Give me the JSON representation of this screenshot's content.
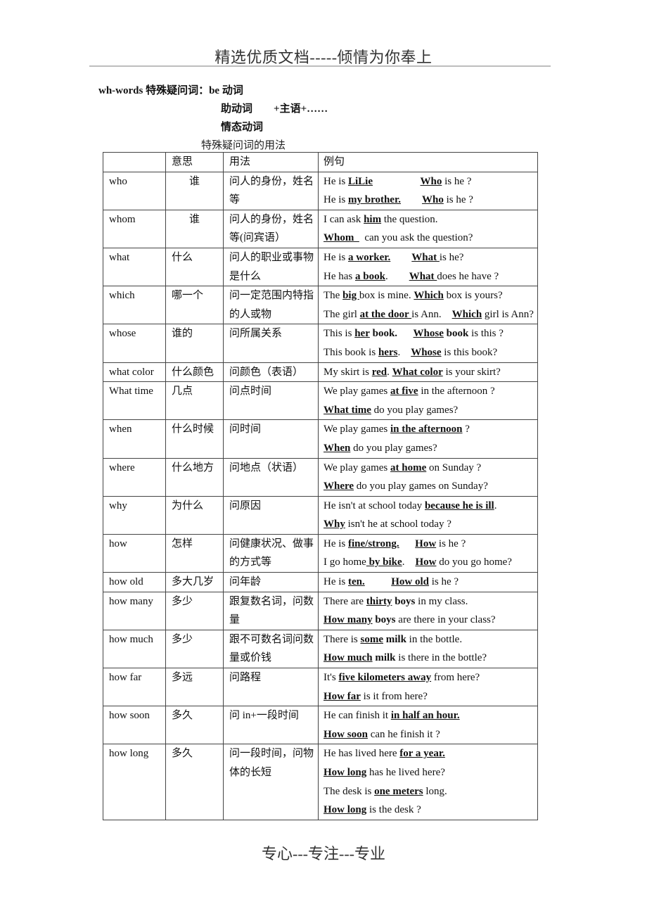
{
  "page_header": "精选优质文档-----倾情为你奉上",
  "intro": {
    "line1": "wh-words  特殊疑问词：be 动词",
    "line2_a": "助动词",
    "line2_b": "+主语+……",
    "line3": "情态动词"
  },
  "table_caption": "特殊疑问词的用法",
  "table": {
    "headers": [
      "",
      "意思",
      "用法",
      "例句"
    ],
    "rows": [
      {
        "word": "who",
        "meaning": "谁",
        "usage": "问人的身份，姓名等",
        "examples": [
          [
            {
              "t": "He is "
            },
            {
              "t": "LiLie",
              "s": "u"
            },
            {
              "t": "                  "
            },
            {
              "t": "Who",
              "s": "u"
            },
            {
              "t": " is he ?"
            }
          ],
          [
            {
              "t": "He is "
            },
            {
              "t": "my brother.",
              "s": "u"
            },
            {
              "t": "        "
            },
            {
              "t": "Who",
              "s": "u"
            },
            {
              "t": " is he ?"
            }
          ]
        ]
      },
      {
        "word": "whom",
        "meaning": "谁",
        "usage": "问人的身份，姓名等(问宾语）",
        "examples": [
          [
            {
              "t": "I can ask "
            },
            {
              "t": "him",
              "s": "u"
            },
            {
              "t": " the question."
            }
          ],
          [
            {
              "t": "Whom  ",
              "s": "u"
            },
            {
              "t": "  can you ask the question?"
            }
          ]
        ]
      },
      {
        "word": "what",
        "meaning": "什么",
        "usage": "问人的职业或事物是什么",
        "examples": [
          [
            {
              "t": "He is "
            },
            {
              "t": "a worker.",
              "s": "u"
            },
            {
              "t": "        "
            },
            {
              "t": "What ",
              "s": "u"
            },
            {
              "t": "is he?"
            }
          ],
          [
            {
              "t": "He has "
            },
            {
              "t": "a book",
              "s": "u"
            },
            {
              "t": ".        "
            },
            {
              "t": "What ",
              "s": "u"
            },
            {
              "t": "does he have ?"
            }
          ]
        ]
      },
      {
        "word": "which",
        "meaning": "哪一个",
        "usage": "问一定范围内特指的人或物",
        "examples": [
          [
            {
              "t": "The "
            },
            {
              "t": "big ",
              "s": "u"
            },
            {
              "t": "box is mine. "
            },
            {
              "t": "Which",
              "s": "u"
            },
            {
              "t": " box is yours?"
            }
          ],
          [
            {
              "t": "The girl "
            },
            {
              "t": "at the door ",
              "s": "u"
            },
            {
              "t": "is Ann.    "
            },
            {
              "t": "Which",
              "s": "u"
            },
            {
              "t": " girl is Ann?"
            }
          ]
        ]
      },
      {
        "word": "whose",
        "meaning": "谁的",
        "usage": "问所属关系",
        "examples": [
          [
            {
              "t": "This is "
            },
            {
              "t": "her",
              "s": "u"
            },
            {
              "t": " "
            },
            {
              "t": "book.",
              "s": "b"
            },
            {
              "t": "      "
            },
            {
              "t": "Whose",
              "s": "u"
            },
            {
              "t": " "
            },
            {
              "t": "book",
              "s": "b"
            },
            {
              "t": " is this ?"
            }
          ],
          [
            {
              "t": "This book is "
            },
            {
              "t": "hers",
              "s": "u"
            },
            {
              "t": ".    "
            },
            {
              "t": "Whose",
              "s": "u"
            },
            {
              "t": " is this book?"
            }
          ]
        ]
      },
      {
        "word": "what color",
        "meaning": "什么颜色",
        "usage": "问颜色（表语）",
        "examples": [
          [
            {
              "t": "My skirt is "
            },
            {
              "t": "red",
              "s": "u"
            },
            {
              "t": ". "
            },
            {
              "t": "What color",
              "s": "u"
            },
            {
              "t": " is your skirt?"
            }
          ]
        ]
      },
      {
        "word": "What time",
        "meaning": "几点",
        "usage": "问点时间",
        "examples": [
          [
            {
              "t": "We play games "
            },
            {
              "t": "at five",
              "s": "u"
            },
            {
              "t": " in the afternoon ?"
            }
          ],
          [
            {
              "t": "What time",
              "s": "u"
            },
            {
              "t": " do you play games?"
            }
          ]
        ]
      },
      {
        "word": "when",
        "meaning": "什么时候",
        "usage": "问时间",
        "examples": [
          [
            {
              "t": "We play games "
            },
            {
              "t": "in the afternoon",
              "s": "u"
            },
            {
              "t": " ?"
            }
          ],
          [
            {
              "t": "When",
              "s": "u"
            },
            {
              "t": " do you play games?"
            }
          ]
        ]
      },
      {
        "word": "where",
        "meaning": "什么地方",
        "usage": "问地点（状语）",
        "examples": [
          [
            {
              "t": "We play games "
            },
            {
              "t": "at home",
              "s": "u"
            },
            {
              "t": " on Sunday ?"
            }
          ],
          [
            {
              "t": "Where",
              "s": "u"
            },
            {
              "t": " do you play games on Sunday?"
            }
          ]
        ]
      },
      {
        "word": "why",
        "meaning": "为什么",
        "usage": "问原因",
        "examples": [
          [
            {
              "t": "He isn't at school today "
            },
            {
              "t": "because he is ill",
              "s": "u"
            },
            {
              "t": "."
            }
          ],
          [
            {
              "t": "Why",
              "s": "u"
            },
            {
              "t": " isn't he at school today ?"
            }
          ]
        ]
      },
      {
        "word": "how",
        "meaning": "怎样",
        "usage": "问健康状况、做事的方式等",
        "examples": [
          [
            {
              "t": "He is "
            },
            {
              "t": "fine/strong.",
              "s": "u"
            },
            {
              "t": "      "
            },
            {
              "t": "How",
              "s": "u"
            },
            {
              "t": " is he ?"
            }
          ],
          [
            {
              "t": "I go home"
            },
            {
              "t": " by bike",
              "s": "u"
            },
            {
              "t": ".    "
            },
            {
              "t": "How",
              "s": "u"
            },
            {
              "t": " do you go home?"
            }
          ]
        ]
      },
      {
        "word": "how old",
        "meaning": "多大几岁",
        "usage": "问年龄",
        "examples": [
          [
            {
              "t": "He is "
            },
            {
              "t": "ten.",
              "s": "u"
            },
            {
              "t": "          "
            },
            {
              "t": "How old",
              "s": "u"
            },
            {
              "t": " is he ?"
            }
          ]
        ]
      },
      {
        "word": "how many",
        "meaning": "多少",
        "usage": "跟复数名词，问数量",
        "examples": [
          [
            {
              "t": "There are "
            },
            {
              "t": "thirty",
              "s": "u"
            },
            {
              "t": " "
            },
            {
              "t": "boys",
              "s": "b"
            },
            {
              "t": " in my class."
            }
          ],
          [
            {
              "t": "How many",
              "s": "u"
            },
            {
              "t": " "
            },
            {
              "t": "boys",
              "s": "b"
            },
            {
              "t": " are there in your class?"
            }
          ]
        ]
      },
      {
        "word": "how much",
        "meaning": "多少",
        "usage": "跟不可数名词问数量或价钱",
        "examples": [
          [
            {
              "t": "There is "
            },
            {
              "t": "some",
              "s": "u"
            },
            {
              "t": " "
            },
            {
              "t": "milk",
              "s": "b"
            },
            {
              "t": " in the bottle."
            }
          ],
          [
            {
              "t": "How much",
              "s": "u"
            },
            {
              "t": " "
            },
            {
              "t": "milk",
              "s": "b"
            },
            {
              "t": " is there in the bottle?"
            }
          ]
        ]
      },
      {
        "word": "how far",
        "meaning": "多远",
        "usage": "问路程",
        "examples": [
          [
            {
              "t": "It's "
            },
            {
              "t": "five kilometers away",
              "s": "u"
            },
            {
              "t": " from here?"
            }
          ],
          [
            {
              "t": "How far",
              "s": "u"
            },
            {
              "t": " is it from here?"
            }
          ]
        ]
      },
      {
        "word": "how soon",
        "meaning": "多久",
        "usage": "问 in+一段时间",
        "examples": [
          [
            {
              "t": "He can finish it "
            },
            {
              "t": "in half an hour.",
              "s": "u"
            }
          ],
          [
            {
              "t": "How soon",
              "s": "u"
            },
            {
              "t": " can he finish it ?"
            }
          ]
        ]
      },
      {
        "word": "how long",
        "meaning": "多久",
        "usage": "问一段时间，问物体的长短",
        "examples": [
          [
            {
              "t": "He has lived here "
            },
            {
              "t": "for a year.",
              "s": "u"
            }
          ],
          [
            {
              "t": "How long",
              "s": "u"
            },
            {
              "t": " has he lived here?"
            }
          ],
          [
            {
              "t": "The desk is "
            },
            {
              "t": "one meters",
              "s": "u"
            },
            {
              "t": " long."
            }
          ],
          [
            {
              "t": "How long",
              "s": "u"
            },
            {
              "t": " is the desk ?"
            }
          ]
        ]
      }
    ]
  },
  "page_footer": "专心---专注---专业"
}
